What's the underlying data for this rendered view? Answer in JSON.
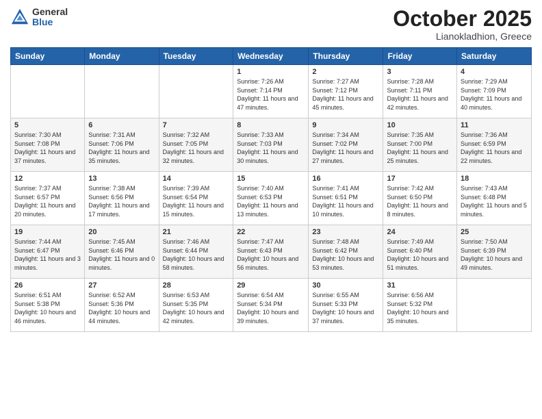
{
  "logo": {
    "general": "General",
    "blue": "Blue"
  },
  "title": "October 2025",
  "location": "Lianokladhion, Greece",
  "days": [
    "Sunday",
    "Monday",
    "Tuesday",
    "Wednesday",
    "Thursday",
    "Friday",
    "Saturday"
  ],
  "weeks": [
    [
      {
        "num": "",
        "sunrise": "",
        "sunset": "",
        "daylight": ""
      },
      {
        "num": "",
        "sunrise": "",
        "sunset": "",
        "daylight": ""
      },
      {
        "num": "",
        "sunrise": "",
        "sunset": "",
        "daylight": ""
      },
      {
        "num": "1",
        "sunrise": "Sunrise: 7:26 AM",
        "sunset": "Sunset: 7:14 PM",
        "daylight": "Daylight: 11 hours and 47 minutes."
      },
      {
        "num": "2",
        "sunrise": "Sunrise: 7:27 AM",
        "sunset": "Sunset: 7:12 PM",
        "daylight": "Daylight: 11 hours and 45 minutes."
      },
      {
        "num": "3",
        "sunrise": "Sunrise: 7:28 AM",
        "sunset": "Sunset: 7:11 PM",
        "daylight": "Daylight: 11 hours and 42 minutes."
      },
      {
        "num": "4",
        "sunrise": "Sunrise: 7:29 AM",
        "sunset": "Sunset: 7:09 PM",
        "daylight": "Daylight: 11 hours and 40 minutes."
      }
    ],
    [
      {
        "num": "5",
        "sunrise": "Sunrise: 7:30 AM",
        "sunset": "Sunset: 7:08 PM",
        "daylight": "Daylight: 11 hours and 37 minutes."
      },
      {
        "num": "6",
        "sunrise": "Sunrise: 7:31 AM",
        "sunset": "Sunset: 7:06 PM",
        "daylight": "Daylight: 11 hours and 35 minutes."
      },
      {
        "num": "7",
        "sunrise": "Sunrise: 7:32 AM",
        "sunset": "Sunset: 7:05 PM",
        "daylight": "Daylight: 11 hours and 32 minutes."
      },
      {
        "num": "8",
        "sunrise": "Sunrise: 7:33 AM",
        "sunset": "Sunset: 7:03 PM",
        "daylight": "Daylight: 11 hours and 30 minutes."
      },
      {
        "num": "9",
        "sunrise": "Sunrise: 7:34 AM",
        "sunset": "Sunset: 7:02 PM",
        "daylight": "Daylight: 11 hours and 27 minutes."
      },
      {
        "num": "10",
        "sunrise": "Sunrise: 7:35 AM",
        "sunset": "Sunset: 7:00 PM",
        "daylight": "Daylight: 11 hours and 25 minutes."
      },
      {
        "num": "11",
        "sunrise": "Sunrise: 7:36 AM",
        "sunset": "Sunset: 6:59 PM",
        "daylight": "Daylight: 11 hours and 22 minutes."
      }
    ],
    [
      {
        "num": "12",
        "sunrise": "Sunrise: 7:37 AM",
        "sunset": "Sunset: 6:57 PM",
        "daylight": "Daylight: 11 hours and 20 minutes."
      },
      {
        "num": "13",
        "sunrise": "Sunrise: 7:38 AM",
        "sunset": "Sunset: 6:56 PM",
        "daylight": "Daylight: 11 hours and 17 minutes."
      },
      {
        "num": "14",
        "sunrise": "Sunrise: 7:39 AM",
        "sunset": "Sunset: 6:54 PM",
        "daylight": "Daylight: 11 hours and 15 minutes."
      },
      {
        "num": "15",
        "sunrise": "Sunrise: 7:40 AM",
        "sunset": "Sunset: 6:53 PM",
        "daylight": "Daylight: 11 hours and 13 minutes."
      },
      {
        "num": "16",
        "sunrise": "Sunrise: 7:41 AM",
        "sunset": "Sunset: 6:51 PM",
        "daylight": "Daylight: 11 hours and 10 minutes."
      },
      {
        "num": "17",
        "sunrise": "Sunrise: 7:42 AM",
        "sunset": "Sunset: 6:50 PM",
        "daylight": "Daylight: 11 hours and 8 minutes."
      },
      {
        "num": "18",
        "sunrise": "Sunrise: 7:43 AM",
        "sunset": "Sunset: 6:48 PM",
        "daylight": "Daylight: 11 hours and 5 minutes."
      }
    ],
    [
      {
        "num": "19",
        "sunrise": "Sunrise: 7:44 AM",
        "sunset": "Sunset: 6:47 PM",
        "daylight": "Daylight: 11 hours and 3 minutes."
      },
      {
        "num": "20",
        "sunrise": "Sunrise: 7:45 AM",
        "sunset": "Sunset: 6:46 PM",
        "daylight": "Daylight: 11 hours and 0 minutes."
      },
      {
        "num": "21",
        "sunrise": "Sunrise: 7:46 AM",
        "sunset": "Sunset: 6:44 PM",
        "daylight": "Daylight: 10 hours and 58 minutes."
      },
      {
        "num": "22",
        "sunrise": "Sunrise: 7:47 AM",
        "sunset": "Sunset: 6:43 PM",
        "daylight": "Daylight: 10 hours and 56 minutes."
      },
      {
        "num": "23",
        "sunrise": "Sunrise: 7:48 AM",
        "sunset": "Sunset: 6:42 PM",
        "daylight": "Daylight: 10 hours and 53 minutes."
      },
      {
        "num": "24",
        "sunrise": "Sunrise: 7:49 AM",
        "sunset": "Sunset: 6:40 PM",
        "daylight": "Daylight: 10 hours and 51 minutes."
      },
      {
        "num": "25",
        "sunrise": "Sunrise: 7:50 AM",
        "sunset": "Sunset: 6:39 PM",
        "daylight": "Daylight: 10 hours and 49 minutes."
      }
    ],
    [
      {
        "num": "26",
        "sunrise": "Sunrise: 6:51 AM",
        "sunset": "Sunset: 5:38 PM",
        "daylight": "Daylight: 10 hours and 46 minutes."
      },
      {
        "num": "27",
        "sunrise": "Sunrise: 6:52 AM",
        "sunset": "Sunset: 5:36 PM",
        "daylight": "Daylight: 10 hours and 44 minutes."
      },
      {
        "num": "28",
        "sunrise": "Sunrise: 6:53 AM",
        "sunset": "Sunset: 5:35 PM",
        "daylight": "Daylight: 10 hours and 42 minutes."
      },
      {
        "num": "29",
        "sunrise": "Sunrise: 6:54 AM",
        "sunset": "Sunset: 5:34 PM",
        "daylight": "Daylight: 10 hours and 39 minutes."
      },
      {
        "num": "30",
        "sunrise": "Sunrise: 6:55 AM",
        "sunset": "Sunset: 5:33 PM",
        "daylight": "Daylight: 10 hours and 37 minutes."
      },
      {
        "num": "31",
        "sunrise": "Sunrise: 6:56 AM",
        "sunset": "Sunset: 5:32 PM",
        "daylight": "Daylight: 10 hours and 35 minutes."
      },
      {
        "num": "",
        "sunrise": "",
        "sunset": "",
        "daylight": ""
      }
    ]
  ]
}
